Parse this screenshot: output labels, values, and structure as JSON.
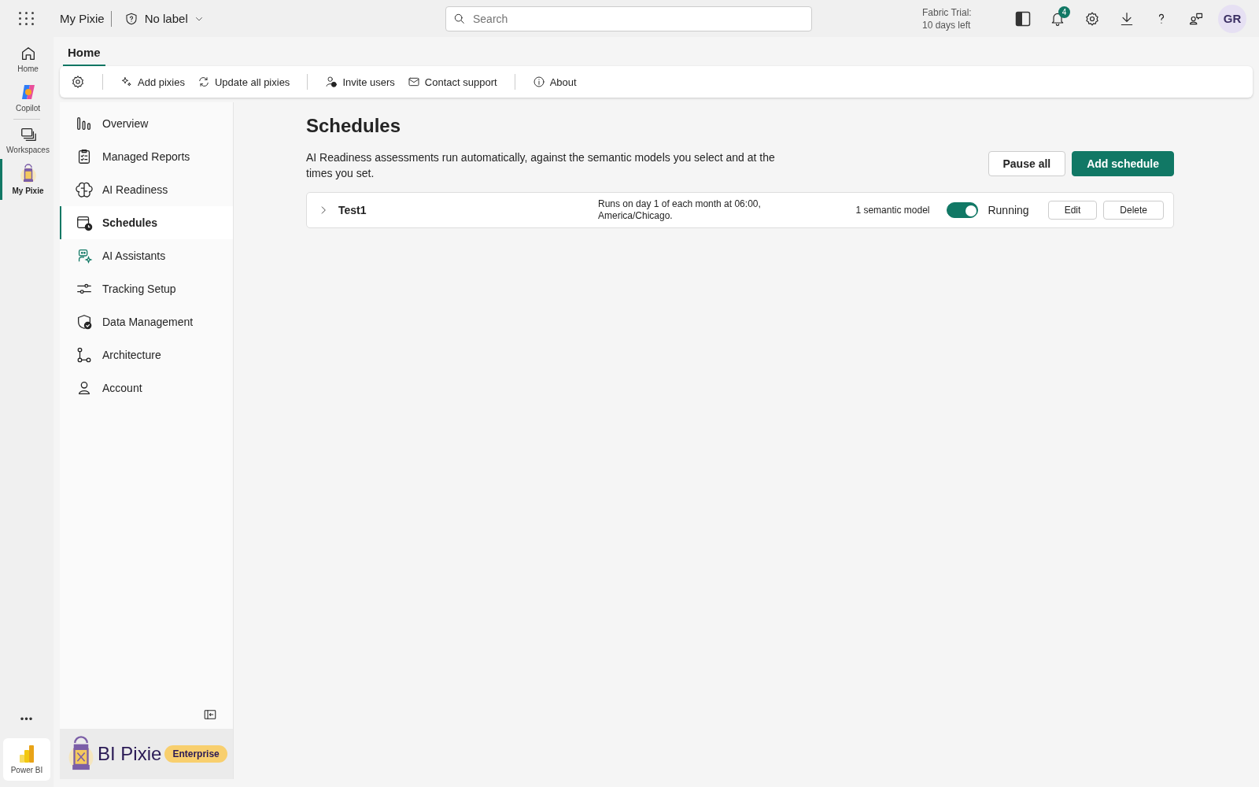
{
  "topbar": {
    "app_name": "My Pixie",
    "label": "No label",
    "search": {
      "placeholder": "Search"
    },
    "trial": [
      "Fabric Trial:",
      "10 days left"
    ],
    "notifications": "4",
    "avatar": "GR"
  },
  "rail": {
    "items": [
      {
        "label": "Home",
        "selected": false
      },
      {
        "label": "Copilot",
        "selected": false
      },
      {
        "label": "Workspaces",
        "selected": false
      },
      {
        "label": "My Pixie",
        "selected": true
      }
    ],
    "more": "•••",
    "bottom": "Power BI"
  },
  "tabs": [
    {
      "label": "Home",
      "selected": true
    }
  ],
  "toolbar": {
    "groups": [
      [
        "Add pixies",
        "Update all pixies"
      ],
      [
        "Invite users",
        "Contact support"
      ],
      [
        "About"
      ]
    ]
  },
  "sidebar": {
    "items": [
      {
        "label": "Overview",
        "selected": false
      },
      {
        "label": "Managed Reports",
        "selected": false
      },
      {
        "label": "AI Readiness",
        "selected": false
      },
      {
        "label": "Schedules",
        "selected": true
      },
      {
        "label": "AI Assistants",
        "selected": false
      },
      {
        "label": "Tracking Setup",
        "selected": false
      },
      {
        "label": "Data Management",
        "selected": false
      },
      {
        "label": "Architecture",
        "selected": false
      },
      {
        "label": "Account",
        "selected": false
      }
    ],
    "brand": "BI Pixie",
    "edition": "Enterprise"
  },
  "main": {
    "title": "Schedules",
    "description": "AI Readiness assessments run automatically, against the semantic models you select and at the times you set.",
    "buttons": [
      "Pause all",
      "Add schedule"
    ],
    "schedules": [
      {
        "name": "Test1",
        "expanded": false,
        "when": "Runs on day 1 of each month at 06:00, America/Chicago.",
        "models": "1 semantic model",
        "on": true,
        "status": "Running",
        "actions": [
          "Edit",
          "Delete"
        ]
      }
    ]
  }
}
